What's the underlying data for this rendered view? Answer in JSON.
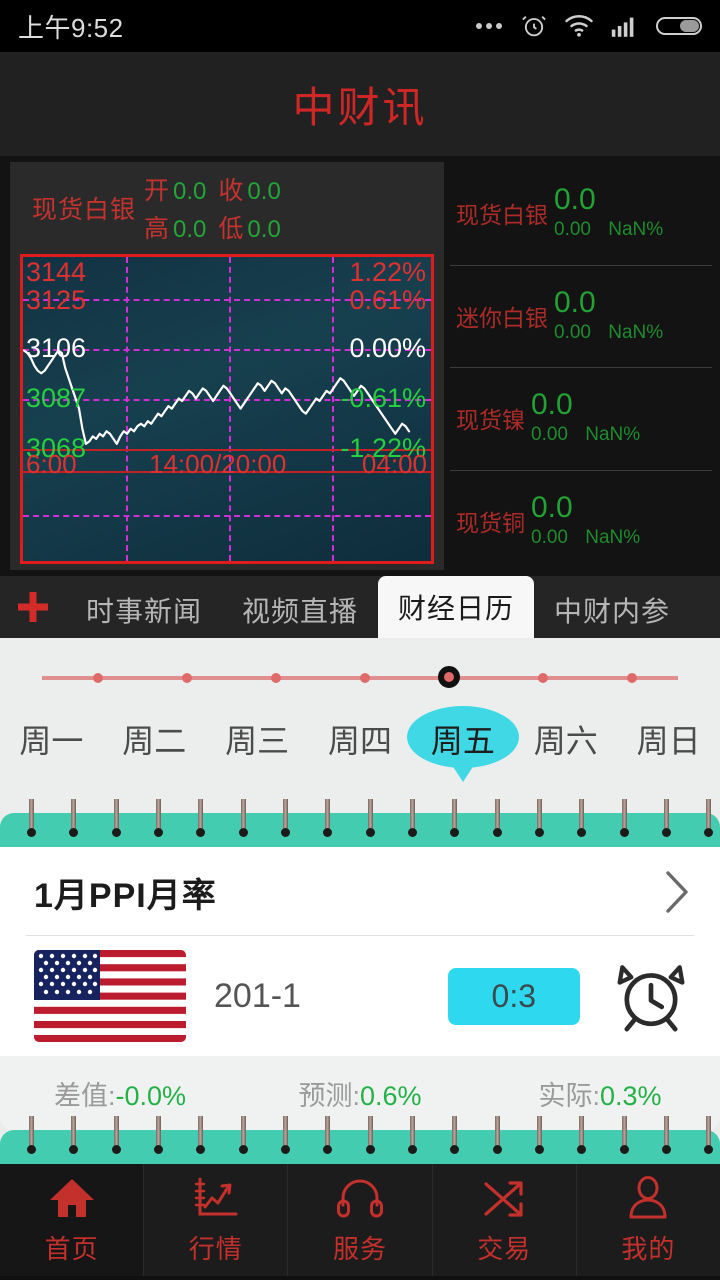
{
  "status": {
    "time": "上午9:52",
    "icons": [
      "more-dots-icon",
      "alarm-icon",
      "wifi-icon",
      "signal-icon",
      "battery-icon"
    ]
  },
  "header": {
    "title": "中财讯"
  },
  "chart_card": {
    "name": "现货白银",
    "ohlc": [
      {
        "label": "开",
        "value": "0.0"
      },
      {
        "label": "收",
        "value": "0.0"
      },
      {
        "label": "高",
        "value": "0.0"
      },
      {
        "label": "低",
        "value": "0.0"
      }
    ]
  },
  "chart_data": {
    "type": "line",
    "title": "现货白银",
    "y_labels": [
      "3144",
      "3125",
      "3106",
      "3087",
      "3068"
    ],
    "pct_labels": [
      "1.22%",
      "0.61%",
      "0.00%",
      "-0.61%",
      "-1.22%"
    ],
    "x_labels": [
      "6:00",
      "14:00/20:00",
      "04:00"
    ],
    "ylim": [
      3068,
      3144
    ],
    "grid": true,
    "legend": "none",
    "series": [
      {
        "name": "现货白银",
        "color": "#ffffff",
        "values": [
          3107,
          3106,
          3104,
          3101,
          3099,
          3098,
          3099,
          3101,
          3103,
          3105,
          3107,
          3106,
          3100,
          3096,
          3092,
          3088,
          3084,
          3076,
          3070,
          3071,
          3073,
          3072,
          3074,
          3073,
          3075,
          3074,
          3072,
          3070,
          3073,
          3075,
          3074,
          3076,
          3075,
          3077,
          3078,
          3077,
          3079,
          3078,
          3080,
          3082,
          3081,
          3083,
          3085,
          3084,
          3086,
          3088,
          3087,
          3089,
          3091,
          3090,
          3088,
          3090,
          3092,
          3091,
          3089,
          3087,
          3089,
          3091,
          3093,
          3092,
          3090,
          3088,
          3086,
          3084,
          3086,
          3088,
          3090,
          3092,
          3094,
          3093,
          3091,
          3093,
          3095,
          3094,
          3092,
          3090,
          3092,
          3091,
          3089,
          3087,
          3085,
          3083,
          3082,
          3084,
          3086,
          3088,
          3087,
          3089,
          3091,
          3090,
          3092,
          3094,
          3096,
          3095,
          3093,
          3091,
          3089,
          3091,
          3093,
          3092,
          3090,
          3088,
          3086,
          3084,
          3082,
          3080,
          3078,
          3076,
          3074,
          3076,
          3078,
          3077,
          3075
        ]
      }
    ]
  },
  "tickers": [
    {
      "name": "现货白银",
      "price": "0.0",
      "change": "0.00",
      "pct": "NaN%"
    },
    {
      "name": "迷你白银",
      "price": "0.0",
      "change": "0.00",
      "pct": "NaN%"
    },
    {
      "name": "现货镍",
      "price": "0.0",
      "change": "0.00",
      "pct": "NaN%"
    },
    {
      "name": "现货铜",
      "price": "0.0",
      "change": "0.00",
      "pct": "NaN%"
    }
  ],
  "tabs": {
    "add_icon": "plus-icon",
    "items": [
      {
        "label": "时事新闻",
        "active": false
      },
      {
        "label": "视频直播",
        "active": false
      },
      {
        "label": "财经日历",
        "active": true
      },
      {
        "label": "中财内参",
        "active": false
      }
    ]
  },
  "week": {
    "days": [
      "周一",
      "周二",
      "周三",
      "周四",
      "周五",
      "周六",
      "周日"
    ],
    "selected_index": 4,
    "selected_label": "周五"
  },
  "event": {
    "title": "1月PPI月率",
    "flag": "us-flag-icon",
    "code": "201-1",
    "countdown": "0:3",
    "alarm_icon": "alarm-clock-icon",
    "stats": [
      {
        "label": "差值:",
        "value": "-0.0%"
      },
      {
        "label": "预测:",
        "value": "0.6%"
      },
      {
        "label": "实际:",
        "value": "0.3%"
      }
    ]
  },
  "bottom_nav": [
    {
      "label": "首页",
      "icon": "home-icon",
      "active": true
    },
    {
      "label": "行情",
      "icon": "chart-icon",
      "active": false
    },
    {
      "label": "服务",
      "icon": "headphones-icon",
      "active": false
    },
    {
      "label": "交易",
      "icon": "shuffle-icon",
      "active": false
    },
    {
      "label": "我的",
      "icon": "person-icon",
      "active": false
    }
  ],
  "colors": {
    "brand_red": "#cf2626",
    "up_green": "#22a235",
    "accent_cyan": "#3fd8e4",
    "binder_teal": "#44ccb1"
  }
}
